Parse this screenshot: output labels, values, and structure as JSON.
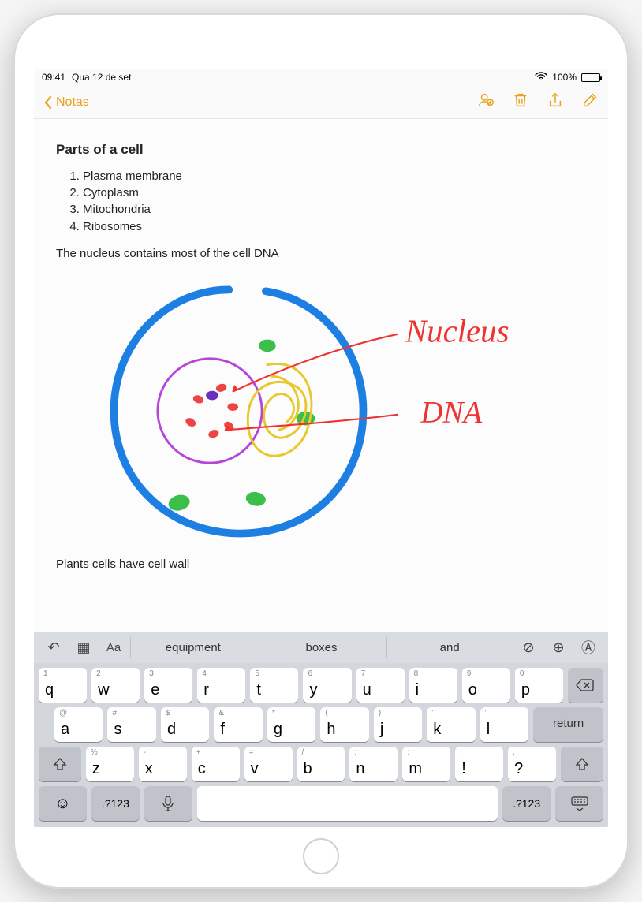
{
  "status": {
    "time": "09:41",
    "date": "Qua 12 de set",
    "wifi_icon": "wifi",
    "battery_pct": "100%"
  },
  "nav": {
    "back_label": "Notas",
    "icons": [
      "share-person",
      "trash",
      "share",
      "compose"
    ]
  },
  "note": {
    "title": "Parts of a cell",
    "items": [
      "Plasma membrane",
      "Cytoplasm",
      "Mitochondria",
      "Ribosomes"
    ],
    "line1": "The nucleus contains most of the cell DNA",
    "sketch_labels": {
      "nucleus": "Nucleus",
      "dna": "DNA"
    },
    "line2": "Plants cells have cell wall"
  },
  "keyboard": {
    "suggestions": [
      "equipment",
      "boxes",
      "and"
    ],
    "row1": [
      {
        "k": "q",
        "s": "1"
      },
      {
        "k": "w",
        "s": "2"
      },
      {
        "k": "e",
        "s": "3"
      },
      {
        "k": "r",
        "s": "4"
      },
      {
        "k": "t",
        "s": "5"
      },
      {
        "k": "y",
        "s": "6"
      },
      {
        "k": "u",
        "s": "7"
      },
      {
        "k": "i",
        "s": "8"
      },
      {
        "k": "o",
        "s": "9"
      },
      {
        "k": "p",
        "s": "0"
      }
    ],
    "row2": [
      {
        "k": "a",
        "s": "@"
      },
      {
        "k": "s",
        "s": "#"
      },
      {
        "k": "d",
        "s": "$"
      },
      {
        "k": "f",
        "s": "&"
      },
      {
        "k": "g",
        "s": "*"
      },
      {
        "k": "h",
        "s": "("
      },
      {
        "k": "j",
        "s": ")"
      },
      {
        "k": "k",
        "s": "'"
      },
      {
        "k": "l",
        "s": "\""
      }
    ],
    "row3": [
      {
        "k": "z",
        "s": "%"
      },
      {
        "k": "x",
        "s": "-"
      },
      {
        "k": "c",
        "s": "+"
      },
      {
        "k": "v",
        "s": "="
      },
      {
        "k": "b",
        "s": "/"
      },
      {
        "k": "n",
        "s": ";"
      },
      {
        "k": "m",
        "s": ":"
      }
    ],
    "punc": [
      {
        "k": "!",
        "s": ","
      },
      {
        "k": "?",
        "s": "."
      }
    ],
    "return": "return",
    "numkey": ".?123"
  }
}
